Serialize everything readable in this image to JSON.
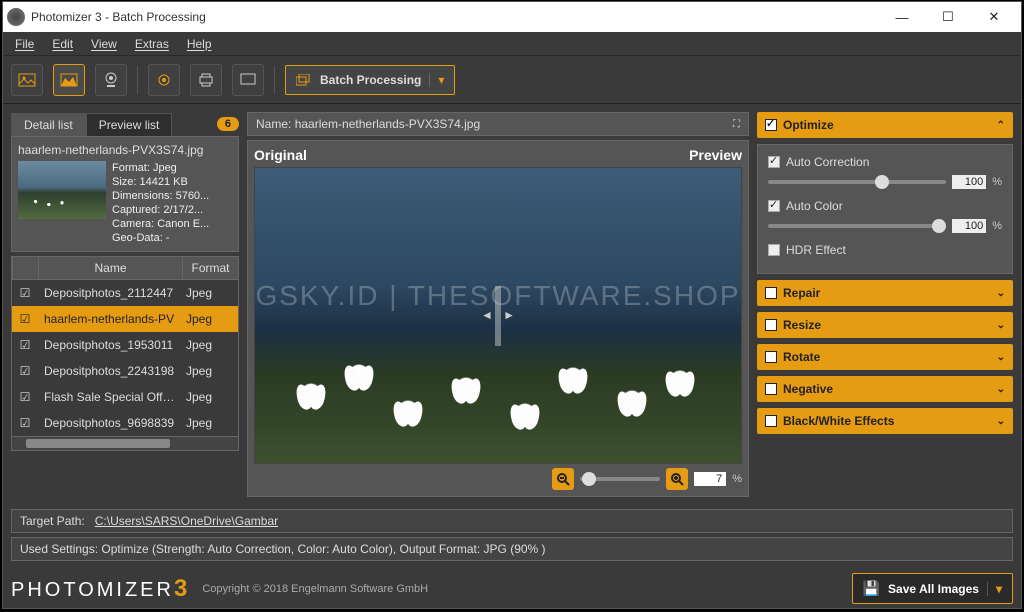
{
  "window": {
    "title": "Photomizer 3 - Batch Processing"
  },
  "menu": {
    "file": "File",
    "edit": "Edit",
    "view": "View",
    "extras": "Extras",
    "help": "Help"
  },
  "toolbar": {
    "mode_label": "Batch Processing"
  },
  "tabs": {
    "detail": "Detail list",
    "preview": "Preview list",
    "badge": "6"
  },
  "detail": {
    "filename": "haarlem-netherlands-PVX3S74.jpg",
    "meta": {
      "format": "Format: Jpeg",
      "size": "Size: 14421 KB",
      "dimensions": "Dimensions: 5760...",
      "captured": "Captured: 2/17/2...",
      "camera": "Camera: Canon E...",
      "geo": "Geo-Data: -"
    }
  },
  "grid": {
    "headers": {
      "name": "Name",
      "format": "Format"
    },
    "rows": [
      {
        "name": "Depositphotos_2112447",
        "format": "Jpeg",
        "selected": false
      },
      {
        "name": "haarlem-netherlands-PV",
        "format": "Jpeg",
        "selected": true
      },
      {
        "name": "Depositphotos_1953011",
        "format": "Jpeg",
        "selected": false
      },
      {
        "name": "Depositphotos_2243198",
        "format": "Jpeg",
        "selected": false
      },
      {
        "name": "Flash Sale Special Offer I",
        "format": "Jpeg",
        "selected": false
      },
      {
        "name": "Depositphotos_9698839",
        "format": "Jpeg",
        "selected": false
      }
    ]
  },
  "preview": {
    "name_label": "Name:",
    "name_value": "haarlem-netherlands-PVX3S74.jpg",
    "left_label": "Original",
    "right_label": "Preview",
    "zoom_value": "7",
    "zoom_pct": "%",
    "watermark": "GSKY.ID | THESOFTWARE.SHOP"
  },
  "optimize": {
    "title": "Optimize",
    "auto_correction": "Auto Correction",
    "auto_correction_val": "100",
    "auto_color": "Auto Color",
    "auto_color_val": "100",
    "hdr": "HDR Effect"
  },
  "panels": {
    "repair": "Repair",
    "resize": "Resize",
    "rotate": "Rotate",
    "negative": "Negative",
    "bw": "Black/White Effects"
  },
  "footer": {
    "target_label": "Target Path:",
    "target_path": "C:\\Users\\SARS\\OneDrive\\Gambar",
    "settings": "Used Settings: Optimize (Strength: Auto Correction, Color: Auto Color), Output Format: JPG (90% )",
    "brand": "PHOTOMIZER",
    "copyright": "Copyright © 2018 Engelmann Software GmbH",
    "save": "Save All Images"
  }
}
